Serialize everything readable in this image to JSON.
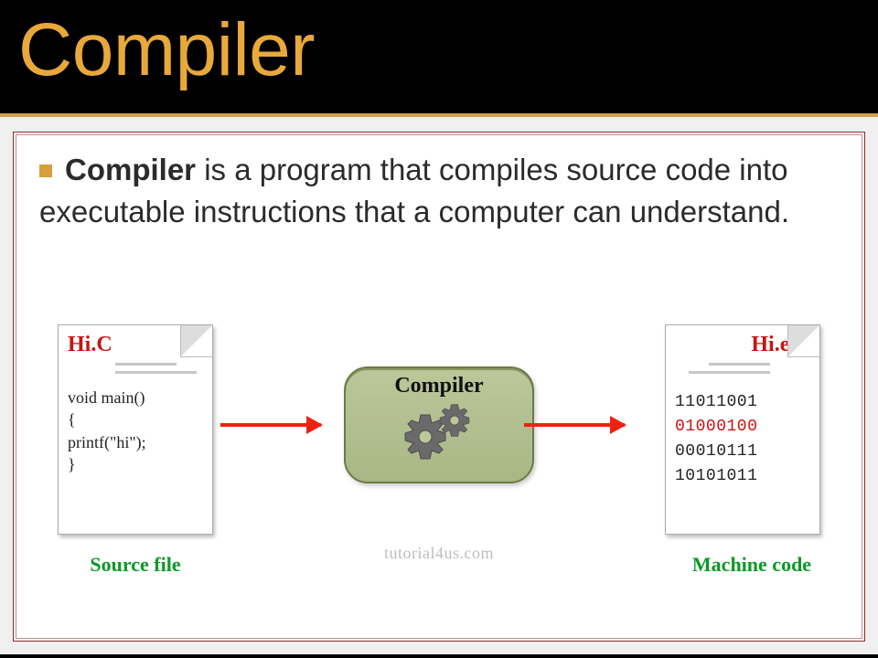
{
  "title": "Compiler",
  "body": {
    "bold": "Compiler",
    "rest": " is a program that compiles source code into executable instructions that a computer can understand."
  },
  "diagram": {
    "source": {
      "filename": "Hi.C",
      "code": "void main()\n{\nprintf(\"hi\");\n}"
    },
    "compiler_label": "Compiler",
    "output": {
      "filename": "Hi.exe",
      "lines": [
        "11011001",
        "01000100",
        "00010111",
        "10101011"
      ],
      "red_index": 1
    },
    "caption_left": "Source file",
    "caption_right": "Machine code",
    "watermark": "tutorial4us.com"
  }
}
